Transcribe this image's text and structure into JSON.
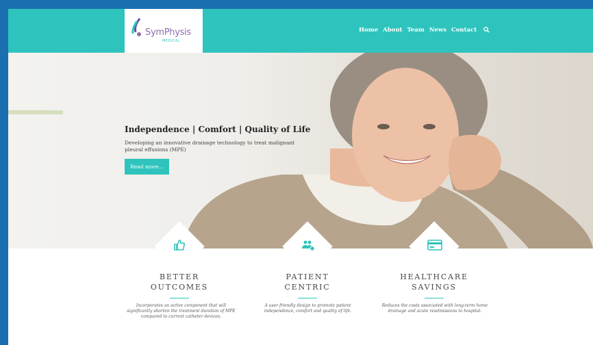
{
  "brand": {
    "name": "SymPhysis",
    "sub": "MEDICAL"
  },
  "nav": {
    "items": [
      "Home",
      "About",
      "Team",
      "News",
      "Contact"
    ]
  },
  "hero": {
    "title": "Independence | Comfort | Quality of Life",
    "subtitle": "Developing an innovative drainage technology to treat malignant pleural effusions (MPE)",
    "button": "Read more..."
  },
  "features": [
    {
      "line1": "BETTER",
      "line2": "OUTCOMES",
      "icon": "thumbs-up-icon",
      "text": "Incorporates an active component that will significantly shorten the treatment duration of MPE compared to current catheter devices."
    },
    {
      "line1": "PATIENT",
      "line2": "CENTRIC",
      "icon": "patients-icon",
      "text": "A user-friendly design to promote patient independence, comfort and quality of life."
    },
    {
      "line1": "HEALTHCARE",
      "line2": "SAVINGS",
      "icon": "credit-card-icon",
      "text": "Reduces the costs associated with long-term home drainage and acute readmissions to hospital."
    }
  ],
  "colors": {
    "accent": "#2ec4bd",
    "background": "#1a6fb0",
    "logo": "#8a6fae"
  }
}
